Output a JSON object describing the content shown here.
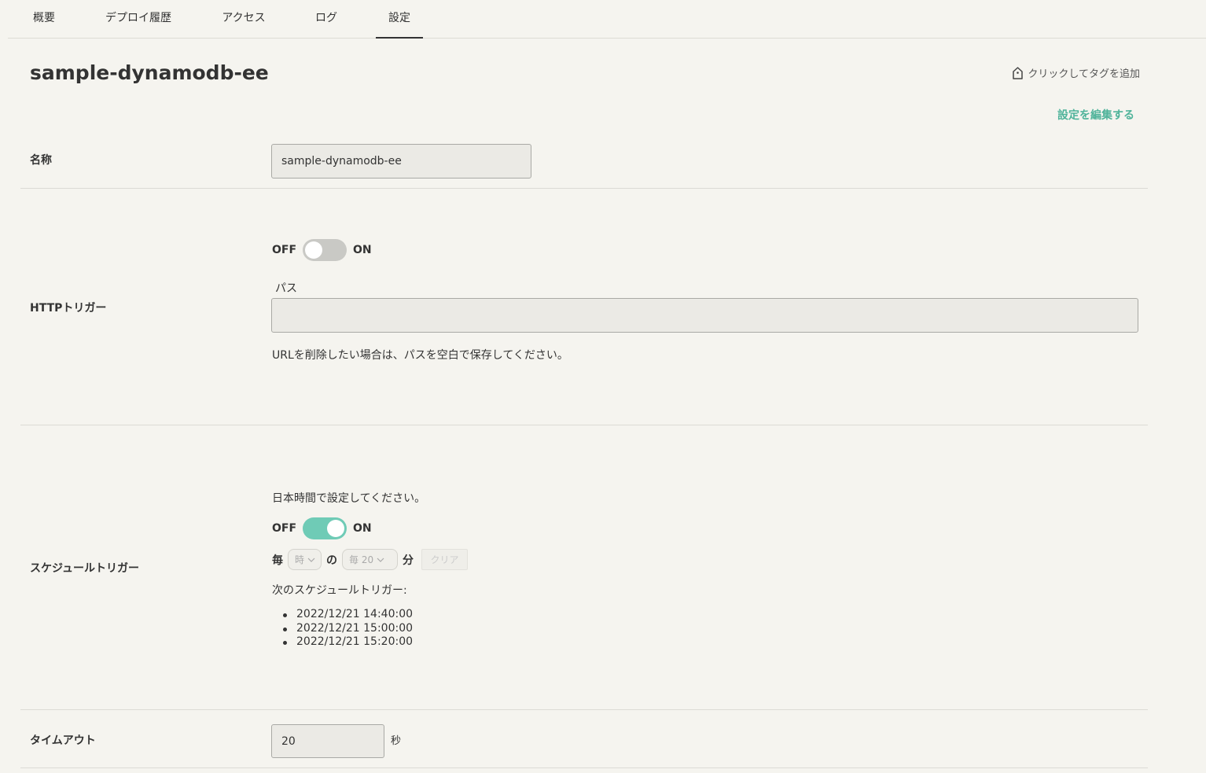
{
  "tabs": [
    {
      "label": "概要"
    },
    {
      "label": "デプロイ履歴"
    },
    {
      "label": "アクセス"
    },
    {
      "label": "ログ"
    },
    {
      "label": "設定",
      "active": true
    }
  ],
  "page_title": "sample-dynamodb-ee",
  "add_tag_label": "クリックしてタグを追加",
  "edit_settings_label": "設定を編集する",
  "name_row": {
    "label": "名称",
    "value": "sample-dynamodb-ee"
  },
  "http_trigger": {
    "label": "HTTPトリガー",
    "off_label": "OFF",
    "on_label": "ON",
    "enabled": false,
    "path_label": "パス",
    "path_value": "",
    "note": "URLを削除したい場合は、パスを空白で保存してください。"
  },
  "schedule_trigger": {
    "label": "スケジュールトリガー",
    "timezone_note": "日本時間で設定してください。",
    "off_label": "OFF",
    "on_label": "ON",
    "enabled": true,
    "every_label": "毎",
    "unit_select": "時",
    "of_label": "の",
    "minute_select": "毎 20",
    "minute_label": "分",
    "clear_label": "クリア",
    "next_heading": "次のスケジュールトリガー:",
    "next_runs": [
      "2022/12/21 14:40:00",
      "2022/12/21 15:00:00",
      "2022/12/21 15:20:00"
    ]
  },
  "timeout": {
    "label": "タイムアウト",
    "value": "20",
    "unit": "秒"
  },
  "colors": {
    "accent": "#4fb39a",
    "toggle_on": "#6fcbb6",
    "background": "#f5f4ef"
  }
}
